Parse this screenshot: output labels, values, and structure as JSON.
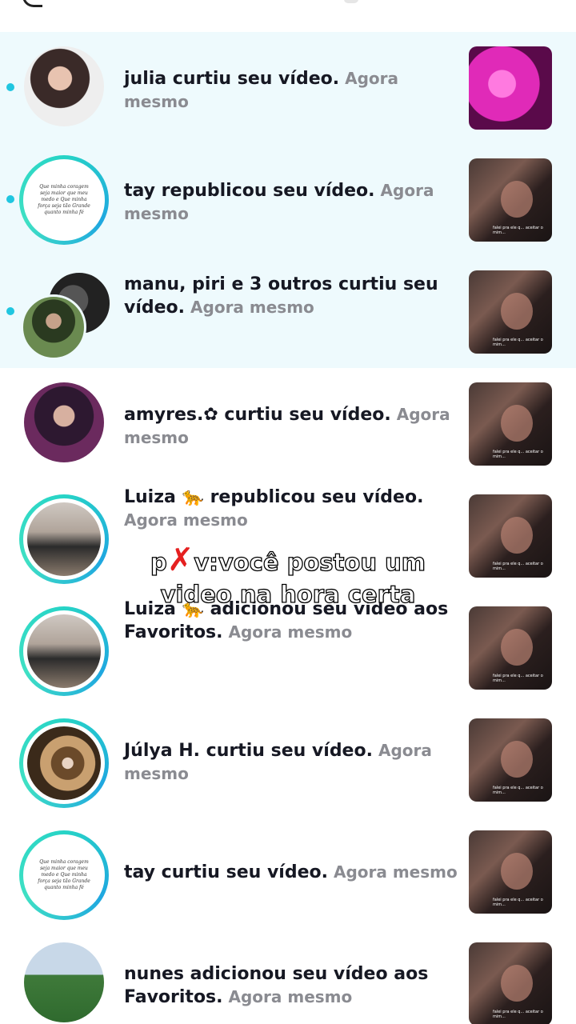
{
  "overlay": {
    "prefix": "p",
    "x_mark": "✗",
    "line1_rest": "v:você postou um",
    "line2": "video na hora certa"
  },
  "notifications": [
    {
      "text": "julia curtiu seu vídeo.",
      "time": "Agora mesmo",
      "unread": true
    },
    {
      "text": "tay republicou seu vídeo.",
      "time": "Agora mesmo",
      "unread": true
    },
    {
      "text": "manu, piri e 3 outros curtiu seu vídeo.",
      "time": "Agora mesmo",
      "unread": true
    },
    {
      "text": "amyres.✿ curtiu seu vídeo.",
      "time": "Agora mesmo",
      "unread": false
    },
    {
      "text": "Luiza 🐆 republicou seu vídeo.",
      "time": "Agora mesmo",
      "unread": false
    },
    {
      "text": "Luiza 🐆 adicionou seu vídeo aos Favoritos.",
      "time": "Agora mesmo",
      "unread": false
    },
    {
      "text": "Júlya H. curtiu seu vídeo.",
      "time": "Agora mesmo",
      "unread": false
    },
    {
      "text": "tay curtiu seu vídeo.",
      "time": "Agora mesmo",
      "unread": false
    },
    {
      "text": "nunes adicionou seu vídeo aos Favoritos.",
      "time": "Agora mesmo",
      "unread": false
    }
  ],
  "avatar_quote": "Que minha coragem seja maior que meu medo e Que minha força seja tão Grande quanto minha fé",
  "thumb_caption": "falei pra ele q... aceitar o mim...",
  "colors": {
    "accent": "#20c6e0",
    "unread_bg": "#eefafd",
    "time_gray": "#8a8b91"
  }
}
